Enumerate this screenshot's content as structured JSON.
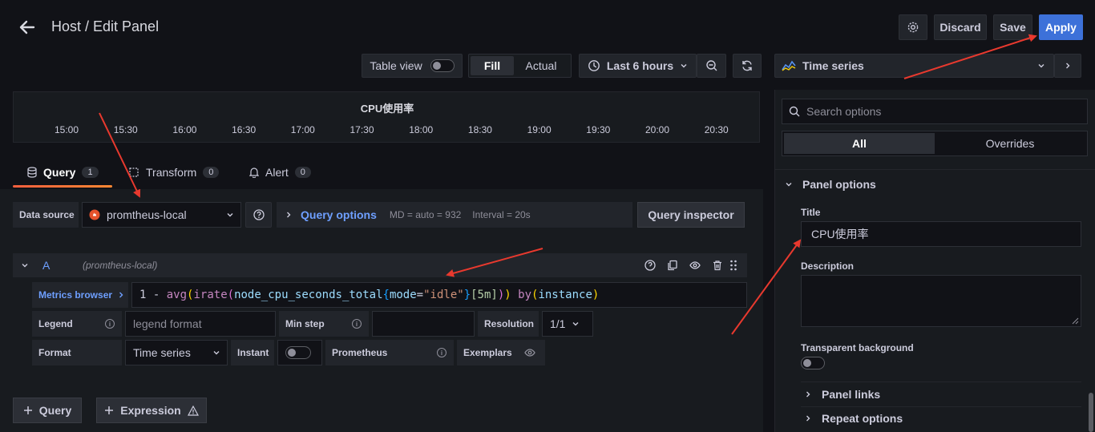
{
  "header": {
    "title": "Host / Edit Panel",
    "discard_label": "Discard",
    "save_label": "Save",
    "apply_label": "Apply"
  },
  "toolbar": {
    "table_view_label": "Table view",
    "table_view_on": false,
    "fill_label": "Fill",
    "actual_label": "Actual",
    "time_range_label": "Last 6 hours",
    "visualization_label": "Time series"
  },
  "graph": {
    "title": "CPU使用率",
    "x_ticks": [
      "15:00",
      "15:30",
      "16:00",
      "16:30",
      "17:00",
      "17:30",
      "18:00",
      "18:30",
      "19:00",
      "19:30",
      "20:00",
      "20:30"
    ]
  },
  "tabs": [
    {
      "label": "Query",
      "count": "1"
    },
    {
      "label": "Transform",
      "count": "0"
    },
    {
      "label": "Alert",
      "count": "0"
    }
  ],
  "datasource": {
    "label": "Data source",
    "value": "promtheus-local",
    "query_options_label": "Query options",
    "md_text": "MD = auto = 932",
    "interval_text": "Interval = 20s",
    "inspector_label": "Query inspector"
  },
  "query": {
    "ref_id": "A",
    "ds_name": "(promtheus-local)",
    "metrics_browser_label": "Metrics browser",
    "expr": "1 - avg(irate(node_cpu_seconds_total{mode=\"idle\"}[5m])) by(instance)",
    "legend_label": "Legend",
    "legend_placeholder": "legend format",
    "min_step_label": "Min step",
    "min_step_value": "",
    "resolution_label": "Resolution",
    "resolution_value": "1/1",
    "format_label": "Format",
    "format_value": "Time series",
    "instant_label": "Instant",
    "prometheus_label": "Prometheus",
    "exemplars_label": "Exemplars"
  },
  "add_buttons": {
    "query_label": "Query",
    "expression_label": "Expression"
  },
  "options": {
    "search_placeholder": "Search options",
    "all_label": "All",
    "overrides_label": "Overrides",
    "panel_options_label": "Panel options",
    "title_label": "Title",
    "title_value": "CPU使用率",
    "description_label": "Description",
    "transparent_label": "Transparent background",
    "panel_links_label": "Panel links",
    "repeat_options_label": "Repeat options"
  },
  "colors": {
    "background": "#111217",
    "panel": "#181b1f",
    "accent_blue": "#3d71d9",
    "link_blue": "#6e9fff",
    "annotation_red": "#e8392e",
    "tab_underline": "#f55f3e"
  }
}
